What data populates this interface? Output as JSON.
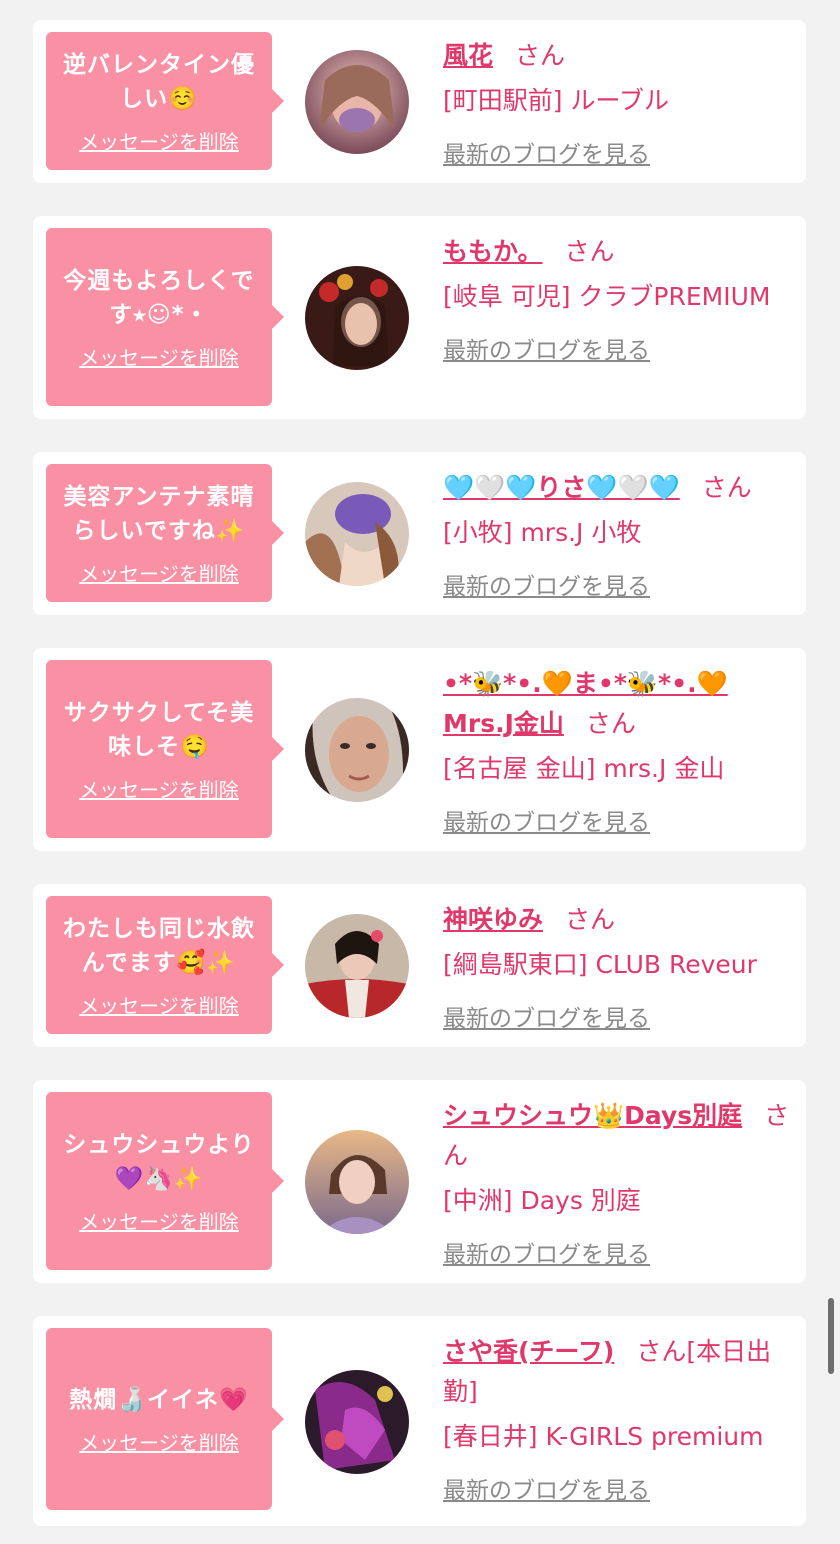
{
  "colors": {
    "accent": "#e0386a",
    "bubble": "#f990a3",
    "link_gray": "#8a8a8a",
    "background": "#f2f2f2"
  },
  "entries": [
    {
      "message": "逆バレンタイン優しい☺️",
      "delete_label": "メッセージを削除",
      "name": "風花",
      "honorific": "さん",
      "shop": "[町田駅前] ルーブル",
      "blog_label": "最新のブログを見る",
      "avatar_icon": "avatar-portrait"
    },
    {
      "message": "今週もよろしくです⭑☺︎*・",
      "delete_label": "メッセージを削除",
      "name": "ももか。",
      "honorific": "さん",
      "shop": "[岐阜 可児] クラブPREMIUM",
      "blog_label": "最新のブログを見る",
      "avatar_icon": "avatar-portrait"
    },
    {
      "message": "美容アンテナ素晴らしいですね✨",
      "delete_label": "メッセージを削除",
      "name": "🩵🤍🩵りさ🩵🤍🩵",
      "honorific": "さん",
      "shop": "[小牧] mrs.J 小牧",
      "blog_label": "最新のブログを見る",
      "avatar_icon": "avatar-portrait"
    },
    {
      "message": "サクサクしてそ美味しそ🤤",
      "delete_label": "メッセージを削除",
      "name": "•*🐝*•.🧡ま•*🐝*•.🧡Mrs.J金山",
      "honorific": "さん",
      "shop": "[名古屋 金山] mrs.J 金山",
      "blog_label": "最新のブログを見る",
      "avatar_icon": "avatar-portrait"
    },
    {
      "message": "わたしも同じ水飲んでます🥰✨",
      "delete_label": "メッセージを削除",
      "name": "神咲ゆみ",
      "honorific": "さん",
      "shop": "[綱島駅東口] CLUB Reveur",
      "blog_label": "最新のブログを見る",
      "avatar_icon": "avatar-portrait"
    },
    {
      "message": "シュウシュウより💜🦄✨",
      "delete_label": "メッセージを削除",
      "name": "シュウシュウ👑Days別庭",
      "honorific": "さん",
      "shop": "[中洲] Days 別庭",
      "blog_label": "最新のブログを見る",
      "avatar_icon": "avatar-portrait"
    },
    {
      "message": "熱燗🍶イイネ💗",
      "delete_label": "メッセージを削除",
      "name": "さや香(チーフ)",
      "honorific": "さん[本日出勤]",
      "shop": "[春日井] K-GIRLS premium",
      "blog_label": "最新のブログを見る",
      "avatar_icon": "avatar-portrait"
    }
  ]
}
